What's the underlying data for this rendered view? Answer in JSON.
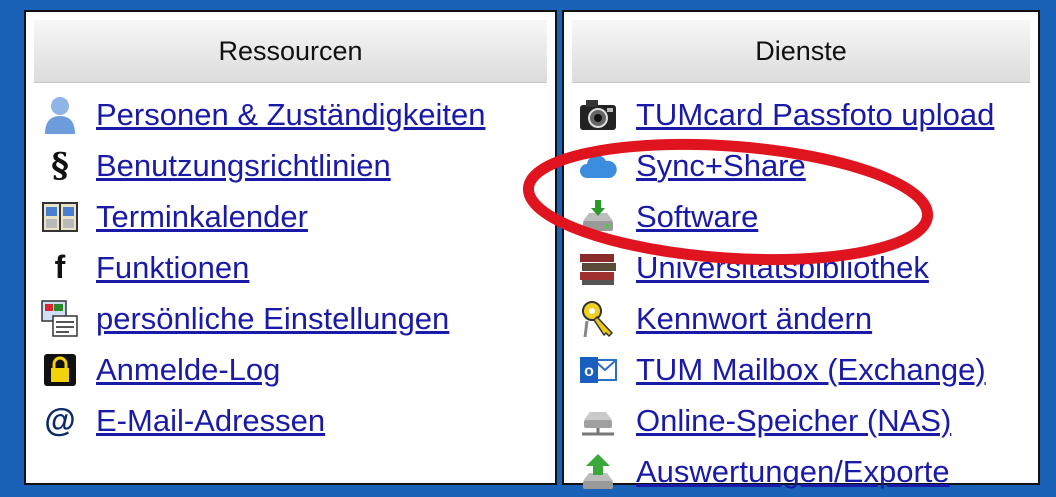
{
  "resources": {
    "title": "Ressourcen",
    "items": [
      {
        "label": "Personen & Zuständigkeiten",
        "icon": "person-icon"
      },
      {
        "label": "Benutzungsrichtlinien",
        "icon": "section-sign-icon",
        "glyph": "§"
      },
      {
        "label": "Terminkalender",
        "icon": "calendar-icon"
      },
      {
        "label": "Funktionen",
        "icon": "function-icon",
        "glyph": "f"
      },
      {
        "label": "persönliche Einstellungen",
        "icon": "settings-icon"
      },
      {
        "label": "Anmelde-Log",
        "icon": "lock-icon"
      },
      {
        "label": "E-Mail-Adressen",
        "icon": "at-sign-icon",
        "glyph": "@"
      }
    ]
  },
  "services": {
    "title": "Dienste",
    "items": [
      {
        "label": "TUMcard Passfoto upload",
        "icon": "camera-icon"
      },
      {
        "label": "Sync+Share",
        "icon": "cloud-icon"
      },
      {
        "label": "Software",
        "icon": "download-drive-icon"
      },
      {
        "label": "Universitätsbibliothek",
        "icon": "books-icon"
      },
      {
        "label": "Kennwort ändern",
        "icon": "keys-icon"
      },
      {
        "label": "TUM Mailbox (Exchange)",
        "icon": "outlook-icon"
      },
      {
        "label": "Online-Speicher (NAS)",
        "icon": "network-drive-icon"
      },
      {
        "label": "Auswertungen/Exporte",
        "icon": "export-icon"
      }
    ]
  },
  "colors": {
    "background": "#1a62b8",
    "link": "#1a1aa8",
    "highlight": "#e0141e"
  }
}
